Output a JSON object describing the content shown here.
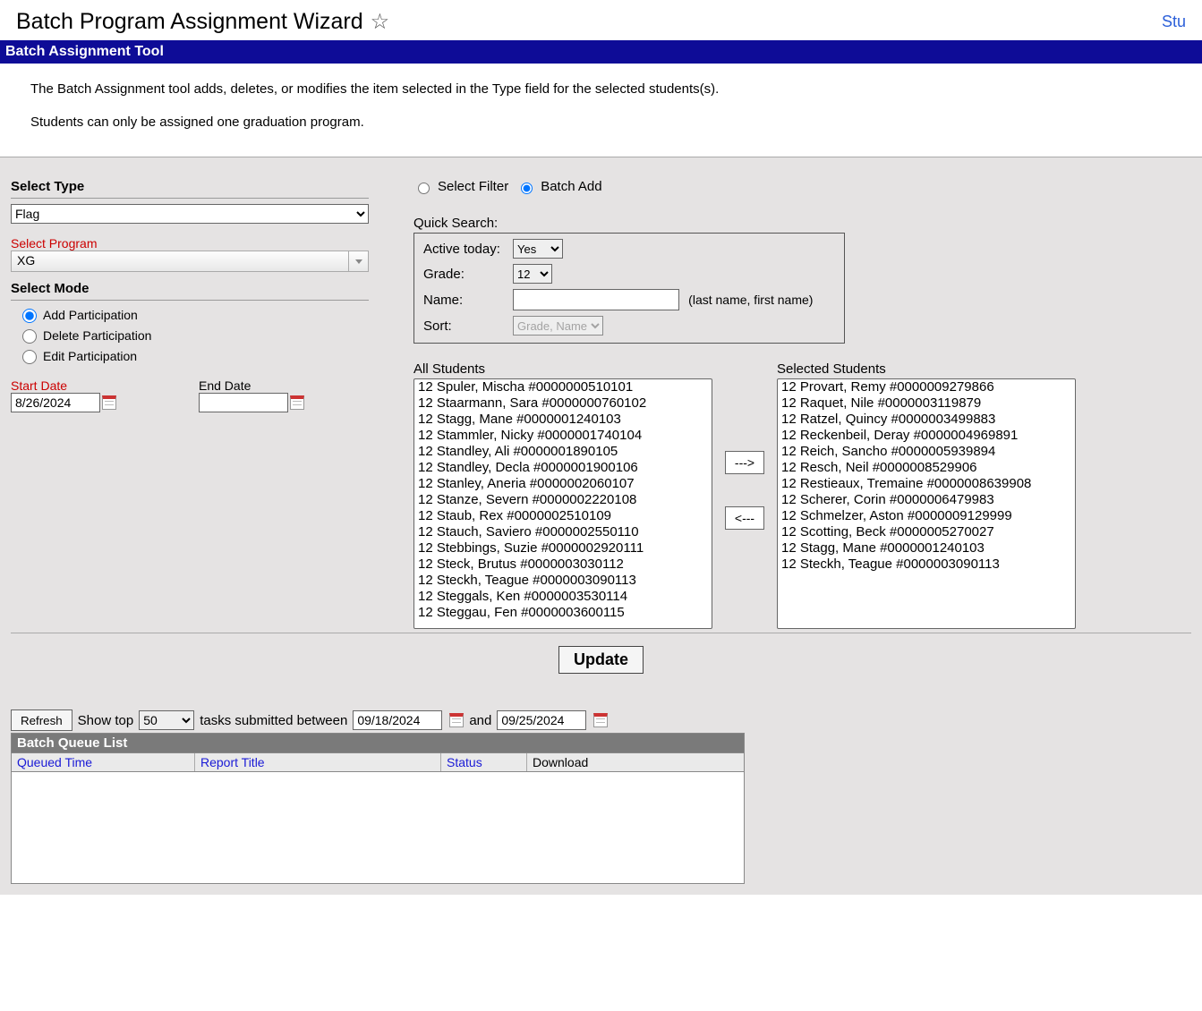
{
  "header": {
    "title": "Batch Program Assignment Wizard",
    "top_right": "Stu"
  },
  "blue_bar": "Batch Assignment Tool",
  "intro": {
    "line1": "The Batch Assignment tool adds, deletes, or modifies the item selected in the Type field for the selected students(s).",
    "line2": "Students can only be assigned one graduation program."
  },
  "left": {
    "select_type_label": "Select Type",
    "select_type_value": "Flag",
    "select_program_label": "Select Program",
    "select_program_value": "XG",
    "select_mode_label": "Select Mode",
    "mode_add": "Add Participation",
    "mode_delete": "Delete Participation",
    "mode_edit": "Edit Participation",
    "start_date_label": "Start Date",
    "start_date_value": "8/26/2024",
    "end_date_label": "End Date",
    "end_date_value": ""
  },
  "filter": {
    "select_filter_label": "Select Filter",
    "batch_add_label": "Batch Add"
  },
  "quick": {
    "title": "Quick Search:",
    "active_label": "Active today:",
    "active_value": "Yes",
    "grade_label": "Grade:",
    "grade_value": "12",
    "name_label": "Name:",
    "name_value": "",
    "name_hint": "(last name, first name)",
    "sort_label": "Sort:",
    "sort_value": "Grade, Name"
  },
  "lists": {
    "all_label": "All Students",
    "selected_label": "Selected Students",
    "move_right": "--->",
    "move_left": "<---",
    "all": [
      "12 Spuler, Mischa  #0000000510101",
      "12 Staarmann, Sara  #0000000760102",
      "12 Stagg, Mane  #0000001240103",
      "12 Stammler, Nicky  #0000001740104",
      "12 Standley, Ali  #0000001890105",
      "12 Standley, Decla  #0000001900106",
      "12 Stanley, Aneria  #0000002060107",
      "12 Stanze, Severn  #0000002220108",
      "12 Staub, Rex  #0000002510109",
      "12 Stauch, Saviero  #0000002550110",
      "12 Stebbings, Suzie  #0000002920111",
      "12 Steck, Brutus  #0000003030112",
      "12 Steckh, Teague  #0000003090113",
      "12 Steggals, Ken  #0000003530114",
      "12 Steggau, Fen  #0000003600115"
    ],
    "selected": [
      "12 Provart, Remy  #0000009279866",
      "12 Raquet, Nile  #0000003119879",
      "12 Ratzel, Quincy  #0000003499883",
      "12 Reckenbeil, Deray  #0000004969891",
      "12 Reich, Sancho  #0000005939894",
      "12 Resch, Neil  #0000008529906",
      "12 Restieaux, Tremaine  #0000008639908",
      "12 Scherer, Corin  #0000006479983",
      "12 Schmelzer, Aston  #0000009129999",
      "12 Scotting, Beck  #0000005270027",
      "12 Stagg, Mane  #0000001240103",
      "12 Steckh, Teague  #0000003090113"
    ]
  },
  "update_label": "Update",
  "queue": {
    "refresh_label": "Refresh",
    "showtop_text": "Show top",
    "showtop_value": "50",
    "between_text": "tasks submitted between",
    "date_from": "09/18/2024",
    "and_text": "and",
    "date_to": "09/25/2024",
    "list_title": "Batch Queue List",
    "col_time": "Queued Time",
    "col_title": "Report Title",
    "col_status": "Status",
    "col_download": "Download"
  }
}
